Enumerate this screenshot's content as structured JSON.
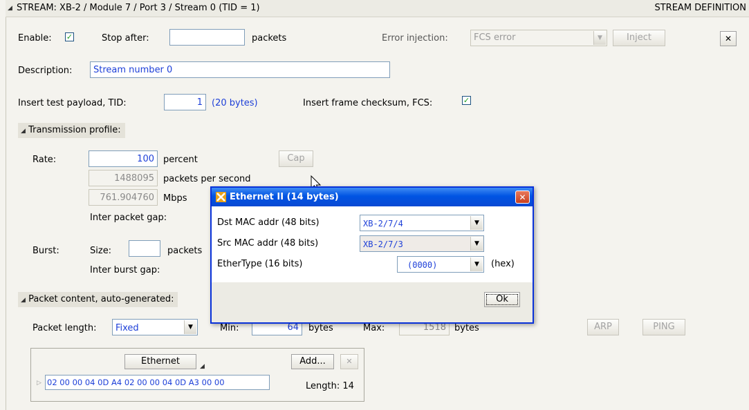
{
  "header": {
    "path": "STREAM: XB-2 / Module 7 / Port 3 / Stream   0  (TID = 1)",
    "right": "STREAM DEFINITION"
  },
  "row1": {
    "enable_label": "Enable:",
    "enable_checked": true,
    "stop_after_label": "Stop after:",
    "stop_after_value": "",
    "packets_label": "packets",
    "error_injection_label": "Error injection:",
    "error_injection_value": "FCS error",
    "inject_label": "Inject",
    "close_glyph": "✕"
  },
  "row2": {
    "description_label": "Description:",
    "description_value": "Stream number 0"
  },
  "row3": {
    "payload_label": "Insert test payload, TID:",
    "tid_value": "1",
    "tid_bytes": "(20 bytes)",
    "fcs_label": "Insert frame checksum, FCS:",
    "fcs_checked": true
  },
  "transmission": {
    "section_label": "Transmission profile:",
    "rate_label": "Rate:",
    "rate_percent": "100",
    "percent_label": "percent",
    "cap_label": "Cap",
    "pps_value": "1488095",
    "pps_label": "packets per second",
    "mbps_value": "761.904760",
    "mbps_label": "Mbps",
    "ipg_label": "Inter packet gap:",
    "burst_label": "Burst:",
    "size_label": "Size:",
    "size_value": "",
    "burst_packets_label": "packets",
    "ibg_label": "Inter burst gap:"
  },
  "packet": {
    "section_label": "Packet content, auto-generated:",
    "length_label": "Packet length:",
    "length_mode": "Fixed",
    "min_label": "Min:",
    "min_value": "64",
    "min_bytes": "bytes",
    "max_label": "Max:",
    "max_value": "1518",
    "max_bytes": "bytes",
    "arp_label": "ARP",
    "ping_label": "PING",
    "ethernet_label": "Ethernet",
    "add_label": "Add...",
    "remove_glyph": "✕",
    "hex": "02 00 00 04 0D A4 02 00 00 04 0D A3 00 00",
    "length_text": "Length: 14"
  },
  "dialog": {
    "title": "Ethernet II  (14 bytes)",
    "dst_label": "Dst MAC addr  (48 bits)",
    "dst_value": "XB-2/7/4",
    "src_label": "Src MAC addr  (48 bits)",
    "src_value": "XB-2/7/3",
    "ethertype_label": "EtherType  (16 bits)",
    "ethertype_value": "(0000)",
    "hex_label": "(hex)",
    "ok_label": "Ok",
    "close_glyph": "✕"
  }
}
